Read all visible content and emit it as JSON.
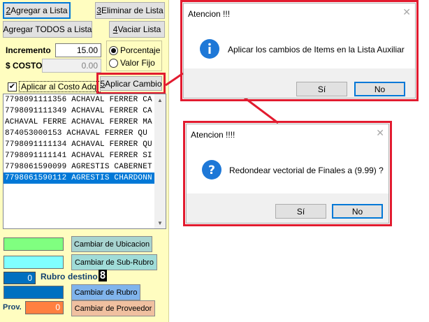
{
  "panel": {
    "buttons": {
      "agregar_key": "2",
      "agregar_rest": " Agregar a Lista",
      "eliminar_key": "3",
      "eliminar_rest": " Eliminar de Lista",
      "agregar_todos": "Agregar TODOS a Lista",
      "vaciar_key": "4",
      "vaciar_rest": " Vaciar Lista",
      "aplicar_key": "5",
      "aplicar_rest": " Aplicar Cambio"
    },
    "incremento_label": "Incremento",
    "incremento_value": "15.00",
    "costo_label": "$ COSTO",
    "costo_value": "0.00",
    "radio_porcentaje": "Porcentaje",
    "radio_valor_fijo": "Valor Fijo",
    "checkbox_label": "Aplicar al Costo Adq.",
    "checkbox_checked": true,
    "list_items": [
      "7798091111356 ACHAVAL FERRER CA",
      "7798091111349 ACHAVAL FERRER CA",
      "ACHAVAL FERRE ACHAVAL FERRER MA",
      "874053000153  ACHAVAL FERRER QU",
      "7798091111134 ACHAVAL FERRER QU",
      "7798091111141 ACHAVAL FERRER SI",
      "7798061590099 AGRESTIS CABERNET",
      "7798061590112 AGRESTIS CHARDONN"
    ],
    "selected_index": 7,
    "actions": {
      "ubicacion": "Cambiar de Ubicacion",
      "subrubro": "Cambiar de Sub-Rubro",
      "rubro": "Cambiar de Rubro",
      "proveedor": "Cambiar de Proveedor"
    },
    "rubro_value": "0",
    "rubro_label": "Rubro",
    "destino_label": "destino",
    "destino_value": "8",
    "prov_label": "Prov.",
    "prov_value": "0",
    "colors": {
      "panel_bg": "#fffdc0",
      "green": "#80ff80",
      "cyan": "#80ffff",
      "blue": "#0070c0",
      "orange": "#ff8040",
      "btn_ubicacion": "#a8d4d0",
      "btn_subrubro": "#a0dcd8",
      "btn_rubro": "#80b4ec",
      "btn_proveedor": "#f0c0a0",
      "highlight": "#e21b2f",
      "selection": "#0078d7"
    }
  },
  "dialog1": {
    "title": "Atencion !!!",
    "message": "Aplicar los cambios de Items en la Lista Auxiliar",
    "icon": "info-icon",
    "yes": "Sí",
    "no": "No"
  },
  "dialog2": {
    "title": "Atencion !!!!",
    "message": "Redondear vectorial de Finales a (9.99) ?",
    "icon": "question-icon",
    "yes": "Sí",
    "no": "No"
  }
}
